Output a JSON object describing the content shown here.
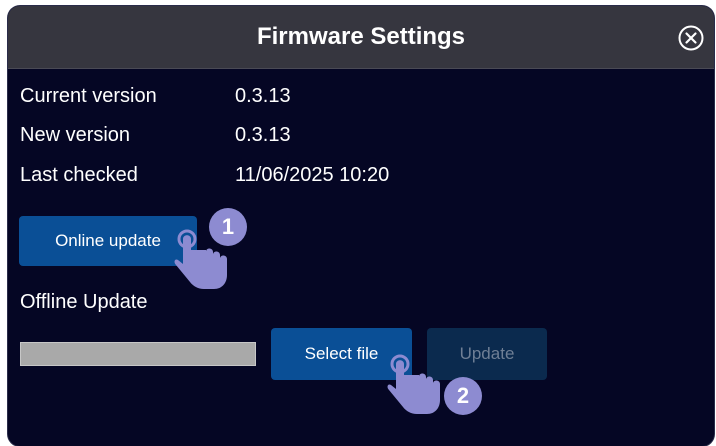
{
  "dialog": {
    "title": "Firmware Settings",
    "close_icon": "close-circle-icon"
  },
  "info": {
    "current_version_label": "Current version",
    "current_version_value": "0.3.13",
    "new_version_label": "New version",
    "new_version_value": "0.3.13",
    "last_checked_label": "Last checked",
    "last_checked_value": "11/06/2025 10:20"
  },
  "online": {
    "button_label": "Online update"
  },
  "offline": {
    "section_label": "Offline Update",
    "file_path_value": "",
    "select_label": "Select file",
    "update_label": "Update"
  },
  "annotations": {
    "step1": "1",
    "step2": "2",
    "hand_icon": "pointing-hand-icon"
  },
  "colors": {
    "background": "#050624",
    "titlebar": "#36363f",
    "primary_button": "#0a4f96",
    "disabled_button": "#0b2a4e",
    "badge": "#8d8bd1",
    "hand": "#8d8bd1"
  }
}
